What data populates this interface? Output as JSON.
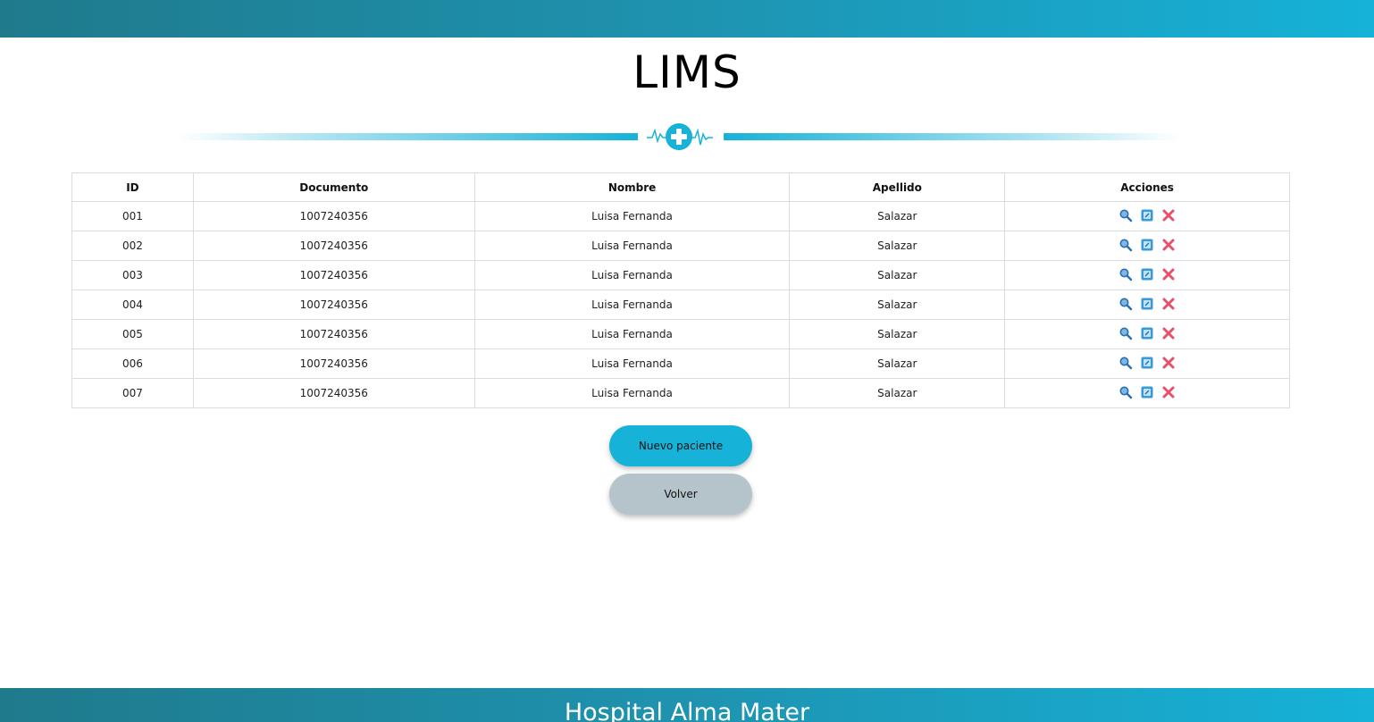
{
  "header": {
    "title": "LIMS"
  },
  "table": {
    "columns": [
      "ID",
      "Documento",
      "Nombre",
      "Apellido",
      "Acciones"
    ],
    "rows": [
      {
        "id": "001",
        "documento": "1007240356",
        "nombre": "Luisa Fernanda",
        "apellido": "Salazar"
      },
      {
        "id": "002",
        "documento": "1007240356",
        "nombre": "Luisa Fernanda",
        "apellido": "Salazar"
      },
      {
        "id": "003",
        "documento": "1007240356",
        "nombre": "Luisa Fernanda",
        "apellido": "Salazar"
      },
      {
        "id": "004",
        "documento": "1007240356",
        "nombre": "Luisa Fernanda",
        "apellido": "Salazar"
      },
      {
        "id": "005",
        "documento": "1007240356",
        "nombre": "Luisa Fernanda",
        "apellido": "Salazar"
      },
      {
        "id": "006",
        "documento": "1007240356",
        "nombre": "Luisa Fernanda",
        "apellido": "Salazar"
      },
      {
        "id": "007",
        "documento": "1007240356",
        "nombre": "Luisa Fernanda",
        "apellido": "Salazar"
      }
    ],
    "action_icons": [
      "search-icon",
      "edit-icon",
      "delete-icon"
    ]
  },
  "buttons": {
    "new_patient": "Nuevo paciente",
    "back": "Volver"
  },
  "footer": {
    "text": "Hospital Alma Mater"
  },
  "colors": {
    "accent": "#16b2d8",
    "bar_start": "#1f7a8c",
    "secondary_button": "#b5c4cb",
    "delete": "#e8506a",
    "search": "#2a6fb0",
    "edit": "#3a9ad9"
  }
}
